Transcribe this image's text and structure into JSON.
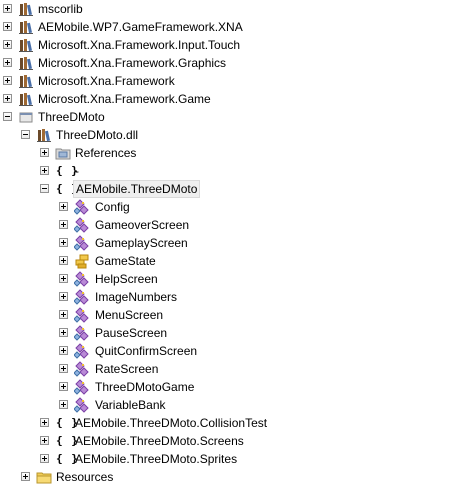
{
  "tree": {
    "assemblies": [
      {
        "label": "mscorlib"
      },
      {
        "label": "AEMobile.WP7.GameFramework.XNA"
      },
      {
        "label": "Microsoft.Xna.Framework.Input.Touch"
      },
      {
        "label": "Microsoft.Xna.Framework.Graphics"
      },
      {
        "label": "Microsoft.Xna.Framework"
      },
      {
        "label": "Microsoft.Xna.Framework.Game"
      }
    ],
    "project": {
      "label": "ThreeDMoto",
      "dll": {
        "label": "ThreeDMoto.dll",
        "references": {
          "label": "References"
        },
        "empty_namespace": {
          "label": "-"
        },
        "main_namespace": {
          "label": "AEMobile.ThreeDMoto",
          "types": [
            {
              "label": "Config",
              "kind": "class"
            },
            {
              "label": "GameoverScreen",
              "kind": "class"
            },
            {
              "label": "GameplayScreen",
              "kind": "class"
            },
            {
              "label": "GameState",
              "kind": "enum"
            },
            {
              "label": "HelpScreen",
              "kind": "class"
            },
            {
              "label": "ImageNumbers",
              "kind": "class"
            },
            {
              "label": "MenuScreen",
              "kind": "class"
            },
            {
              "label": "PauseScreen",
              "kind": "class"
            },
            {
              "label": "QuitConfirmScreen",
              "kind": "class"
            },
            {
              "label": "RateScreen",
              "kind": "class"
            },
            {
              "label": "ThreeDMotoGame",
              "kind": "class"
            },
            {
              "label": "VariableBank",
              "kind": "class"
            }
          ]
        },
        "other_namespaces": [
          {
            "label": "AEMobile.ThreeDMoto.CollisionTest"
          },
          {
            "label": "AEMobile.ThreeDMoto.Screens"
          },
          {
            "label": "AEMobile.ThreeDMoto.Sprites"
          }
        ]
      },
      "resources": {
        "label": "Resources"
      }
    },
    "namespace_glyph": "{ }"
  },
  "colors": {
    "selection_bg": "#efefef",
    "expander_border": "#919191",
    "class_icon_purple": "#7b3fa6",
    "enum_icon_gold": "#d7a318",
    "folder_yellow": "#f2cd57"
  }
}
